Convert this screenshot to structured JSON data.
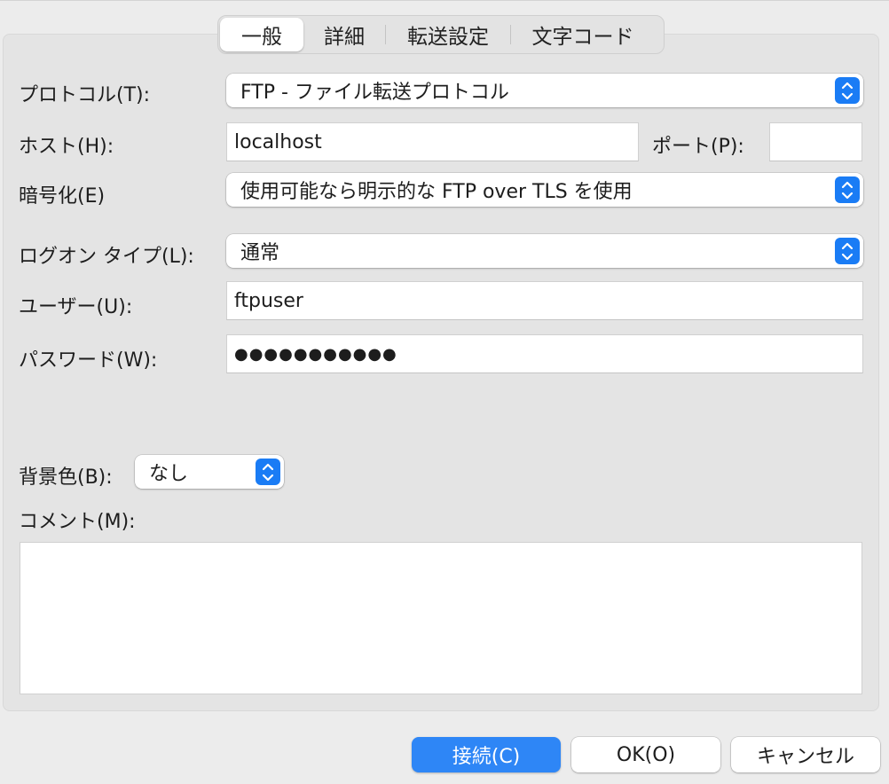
{
  "tabs": [
    {
      "label": "一般",
      "active": true
    },
    {
      "label": "詳細",
      "active": false
    },
    {
      "label": "転送設定",
      "active": false
    },
    {
      "label": "文字コード",
      "active": false
    }
  ],
  "form": {
    "protocol": {
      "label": "プロトコル(T):",
      "value": "FTP - ファイル転送プロトコル"
    },
    "host": {
      "label": "ホスト(H):",
      "value": "localhost"
    },
    "port": {
      "label": "ポート(P):",
      "value": ""
    },
    "encryption": {
      "label": "暗号化(E)",
      "value": "使用可能なら明示的な FTP over TLS を使用"
    },
    "logon_type": {
      "label": "ログオン タイプ(L):",
      "value": "通常"
    },
    "user": {
      "label": "ユーザー(U):",
      "value": "ftpuser"
    },
    "password": {
      "label": "パスワード(W):",
      "value": "●●●●●●●●●●●"
    },
    "background_color": {
      "label": "背景色(B):",
      "value": "なし"
    },
    "comment": {
      "label": "コメント(M):",
      "value": ""
    }
  },
  "buttons": {
    "connect": "接続(C)",
    "ok": "OK(O)",
    "cancel": "キャンセル"
  },
  "colors": {
    "accent": "#2e86f6",
    "stepper": "#1a7cf5"
  }
}
